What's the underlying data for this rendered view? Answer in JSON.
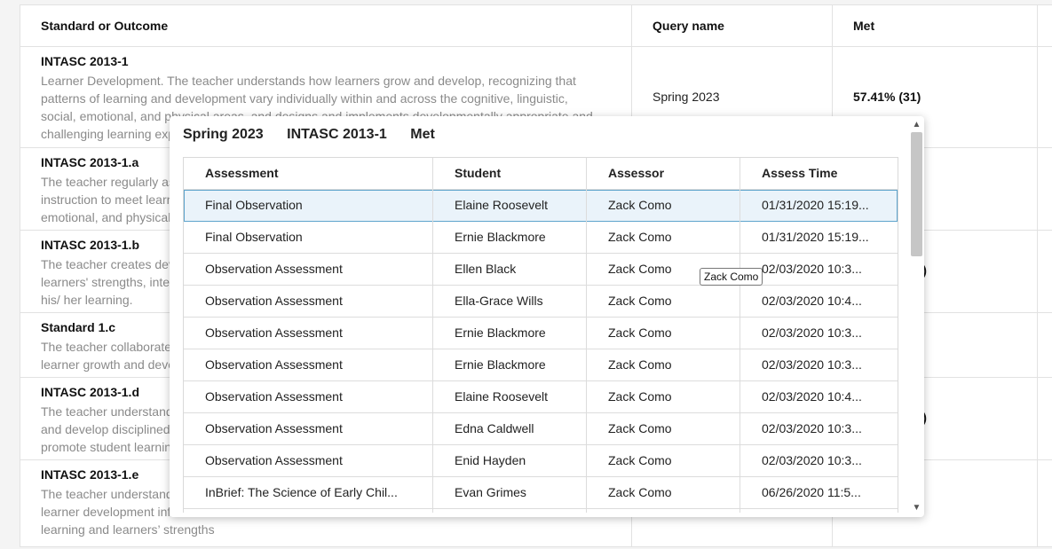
{
  "table": {
    "headers": {
      "standard": "Standard or Outcome",
      "query": "Query name",
      "met": "Met"
    },
    "rows": [
      {
        "title": "INTASC 2013-1",
        "description": "Learner Development. The teacher understands how learners grow and develop, recognizing that patterns of learning and development vary individually within and across the cognitive, linguistic, social, emotional, and physical areas, and designs and implements developmentally appropriate and challenging learning experiences.",
        "query": "Spring 2023",
        "met": "57.41% (31)"
      },
      {
        "title": "INTASC 2013-1.a",
        "description": "The teacher regularly assesses individual and group performance in order to design and modify instruction to meet learners' needs in each area of development (cognitive, linguistic, social, emotional, and physical)."
      },
      {
        "title": "INTASC 2013-1.b",
        "description": "The teacher creates developmentally appropriate instruction that takes into account individual learners' strengths, interests, and needs and that enables each learner to advance and accelerate his/ her learning.",
        "fragment": ")"
      },
      {
        "title": "Standard 1.c",
        "description": "The teacher collaborates with families, communities, colleagues, and other professionals to promote learner growth and development."
      },
      {
        "title": "INTASC 2013-1.d",
        "description": "The teacher understands how learning occurs and how learners construct knowledge, acquire skills, and develop disciplined thinking processes, and knows how to use instructional strategies that promote student learning.",
        "fragment": ")"
      },
      {
        "title": "INTASC 2013-1.e",
        "description": "The teacher understands how learner development infl uences learning and learners’ strengths and needs."
      }
    ]
  },
  "popover": {
    "query": "Spring 2023",
    "standard": "INTASC 2013-1",
    "metric": "Met",
    "columns": [
      "Assessment",
      "Student",
      "Assessor",
      "Assess Time"
    ],
    "rows": [
      [
        "Final Observation",
        "Elaine Roosevelt",
        "Zack Como",
        "01/31/2020 15:19..."
      ],
      [
        "Final Observation",
        "Ernie Blackmore",
        "Zack Como",
        "01/31/2020 15:19..."
      ],
      [
        "Observation Assessment",
        "Ellen Black",
        "Zack Como",
        "02/03/2020 10:3..."
      ],
      [
        "Observation Assessment",
        "Ella-Grace Wills",
        "Zack Como",
        "02/03/2020 10:4..."
      ],
      [
        "Observation Assessment",
        "Ernie Blackmore",
        "Zack Como",
        "02/03/2020 10:3..."
      ],
      [
        "Observation Assessment",
        "Ernie Blackmore",
        "Zack Como",
        "02/03/2020 10:3..."
      ],
      [
        "Observation Assessment",
        "Elaine Roosevelt",
        "Zack Como",
        "02/03/2020 10:4..."
      ],
      [
        "Observation Assessment",
        "Edna Caldwell",
        "Zack Como",
        "02/03/2020 10:3..."
      ],
      [
        "Observation Assessment",
        "Enid Hayden",
        "Zack Como",
        "02/03/2020 10:3..."
      ],
      [
        "InBrief: The Science of Early Chil...",
        "Evan Grimes",
        "Zack Como",
        "06/26/2020 11:5..."
      ],
      [
        "",
        "",
        "",
        ""
      ]
    ],
    "tooltip": "Zack Como",
    "scroll_up_icon": "chevron-up-icon",
    "scroll_down_icon": "chevron-down-icon"
  }
}
